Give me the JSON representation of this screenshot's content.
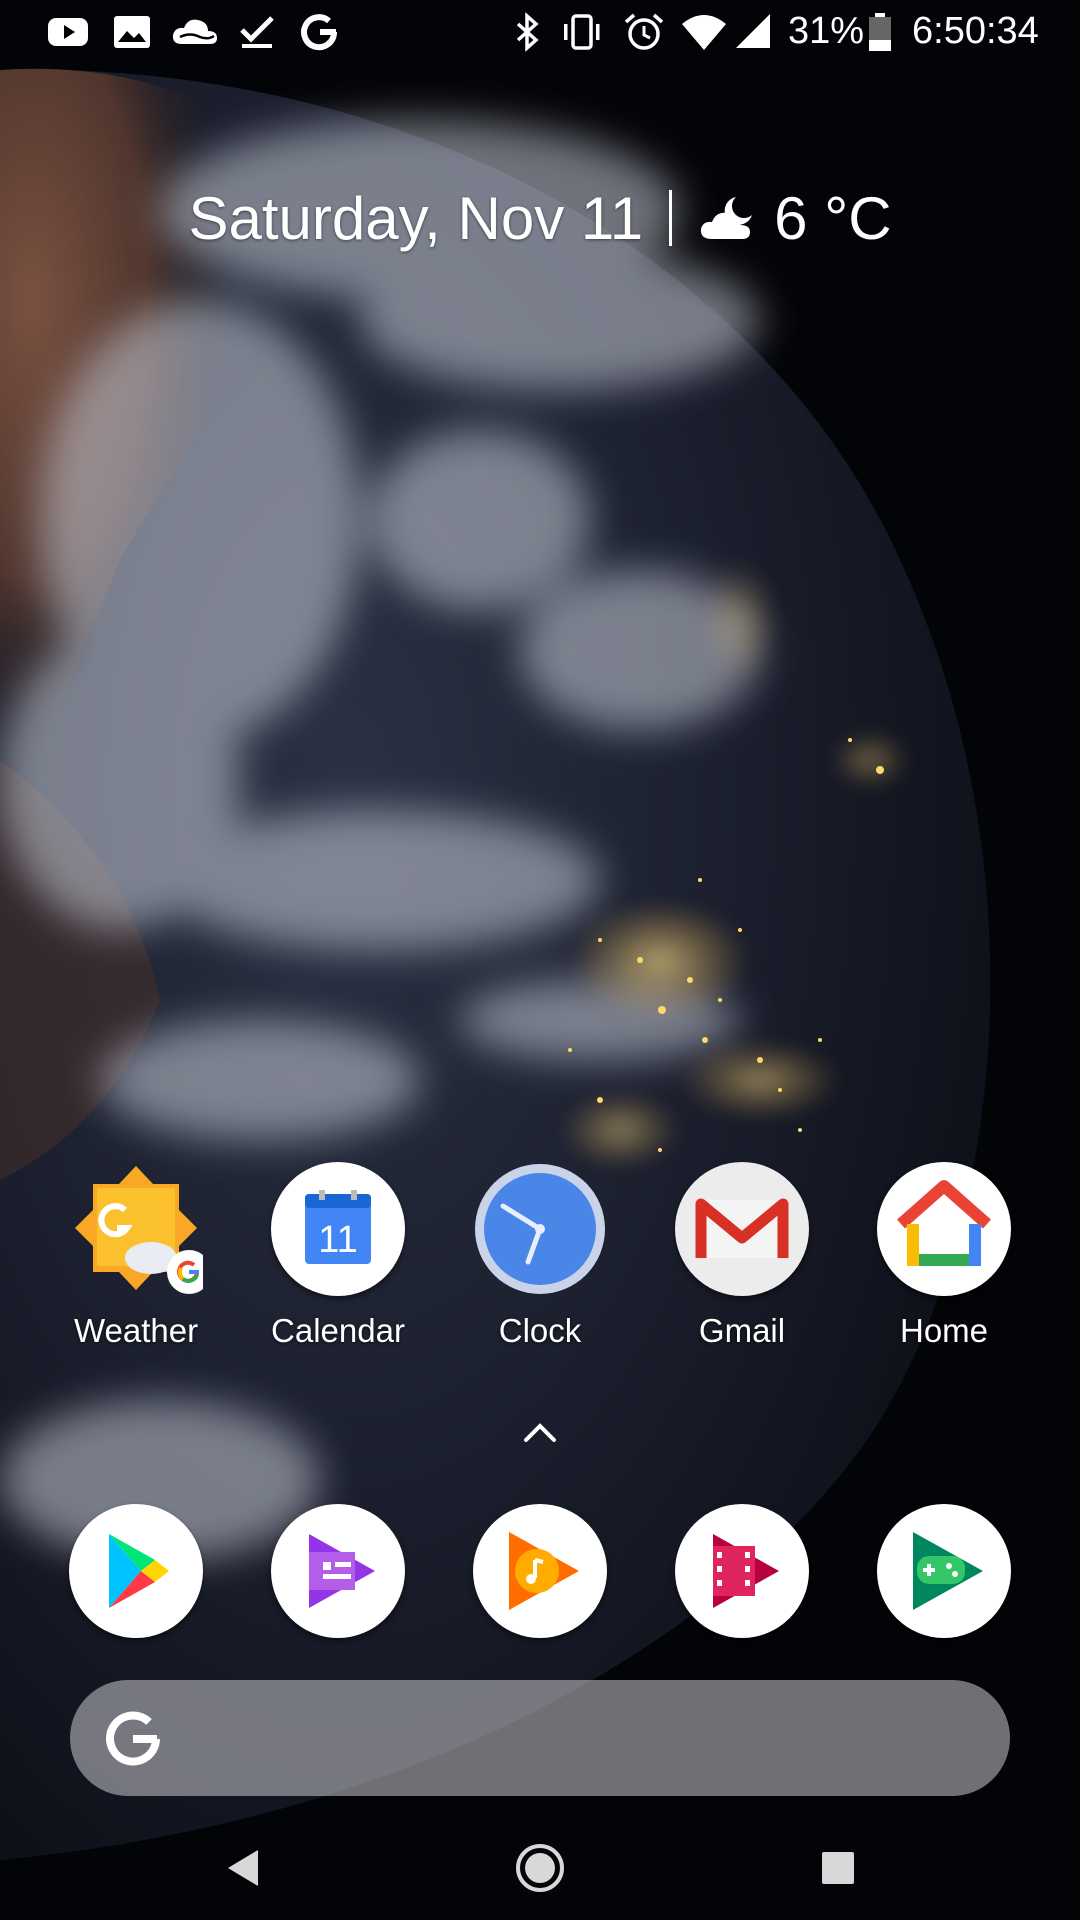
{
  "status_bar": {
    "notification_icons": [
      "youtube-icon",
      "photos-icon",
      "cloud-icon",
      "tasks-check-icon",
      "google-icon"
    ],
    "system_icons": [
      "bluetooth-icon",
      "vibrate-icon",
      "alarm-icon",
      "wifi-icon",
      "cell-signal-icon",
      "battery-icon"
    ],
    "battery_percent": "31%",
    "time": "6:50:34"
  },
  "at_a_glance": {
    "date": "Saturday, Nov 11",
    "weather_icon": "partly-cloudy-night-icon",
    "temperature": "6 °C"
  },
  "home_apps": [
    {
      "label": "Weather",
      "icon": "weather-icon"
    },
    {
      "label": "Calendar",
      "icon": "calendar-icon",
      "badge_text": "11"
    },
    {
      "label": "Clock",
      "icon": "clock-icon"
    },
    {
      "label": "Gmail",
      "icon": "gmail-icon"
    },
    {
      "label": "Home",
      "icon": "google-home-icon"
    }
  ],
  "dock_apps": [
    {
      "icon": "play-store-icon"
    },
    {
      "icon": "play-newsstand-icon"
    },
    {
      "icon": "play-music-icon"
    },
    {
      "icon": "play-movies-icon"
    },
    {
      "icon": "play-games-icon"
    }
  ],
  "search_bar": {
    "icon": "google-g-icon"
  },
  "nav_bar": {
    "buttons": [
      "back-icon",
      "home-icon",
      "recents-icon"
    ]
  },
  "colors": {
    "google_blue": "#4285F4",
    "google_red": "#EA4335",
    "google_yellow": "#FBBC05",
    "google_green": "#34A853"
  }
}
